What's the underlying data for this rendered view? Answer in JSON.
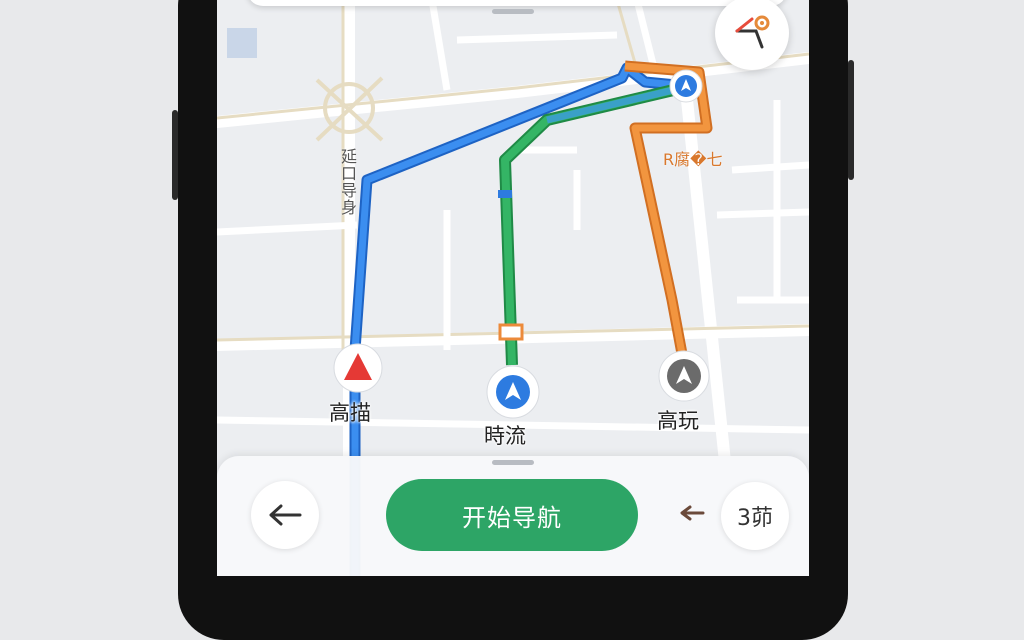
{
  "map": {
    "road_name_vertical": "延口导身",
    "orange_area_label": "R腐�七"
  },
  "routes": [
    {
      "label": "高描",
      "color": "#2d7be0",
      "marker_color": "#e53935",
      "marker_icon": "triangle-up-red"
    },
    {
      "label": "時流",
      "color": "#2ea35a",
      "marker_color": "#2d7be0",
      "marker_icon": "navigation-arrow-blue"
    },
    {
      "label": "高玩",
      "color": "#ec8a3a",
      "marker_color": "#555555",
      "marker_icon": "navigation-arrow-gray"
    }
  ],
  "controls": {
    "start_nav_label": "开始导航",
    "back_icon": "arrow-left-icon",
    "count_label": "3茆",
    "peek_icon": "chevron-left-icon",
    "route_options_icon": "route-options-icon"
  },
  "colors": {
    "primary_green": "#2da566",
    "route_blue": "#2d7be0",
    "route_green": "#2ea35a",
    "route_orange": "#ec8a3a"
  }
}
